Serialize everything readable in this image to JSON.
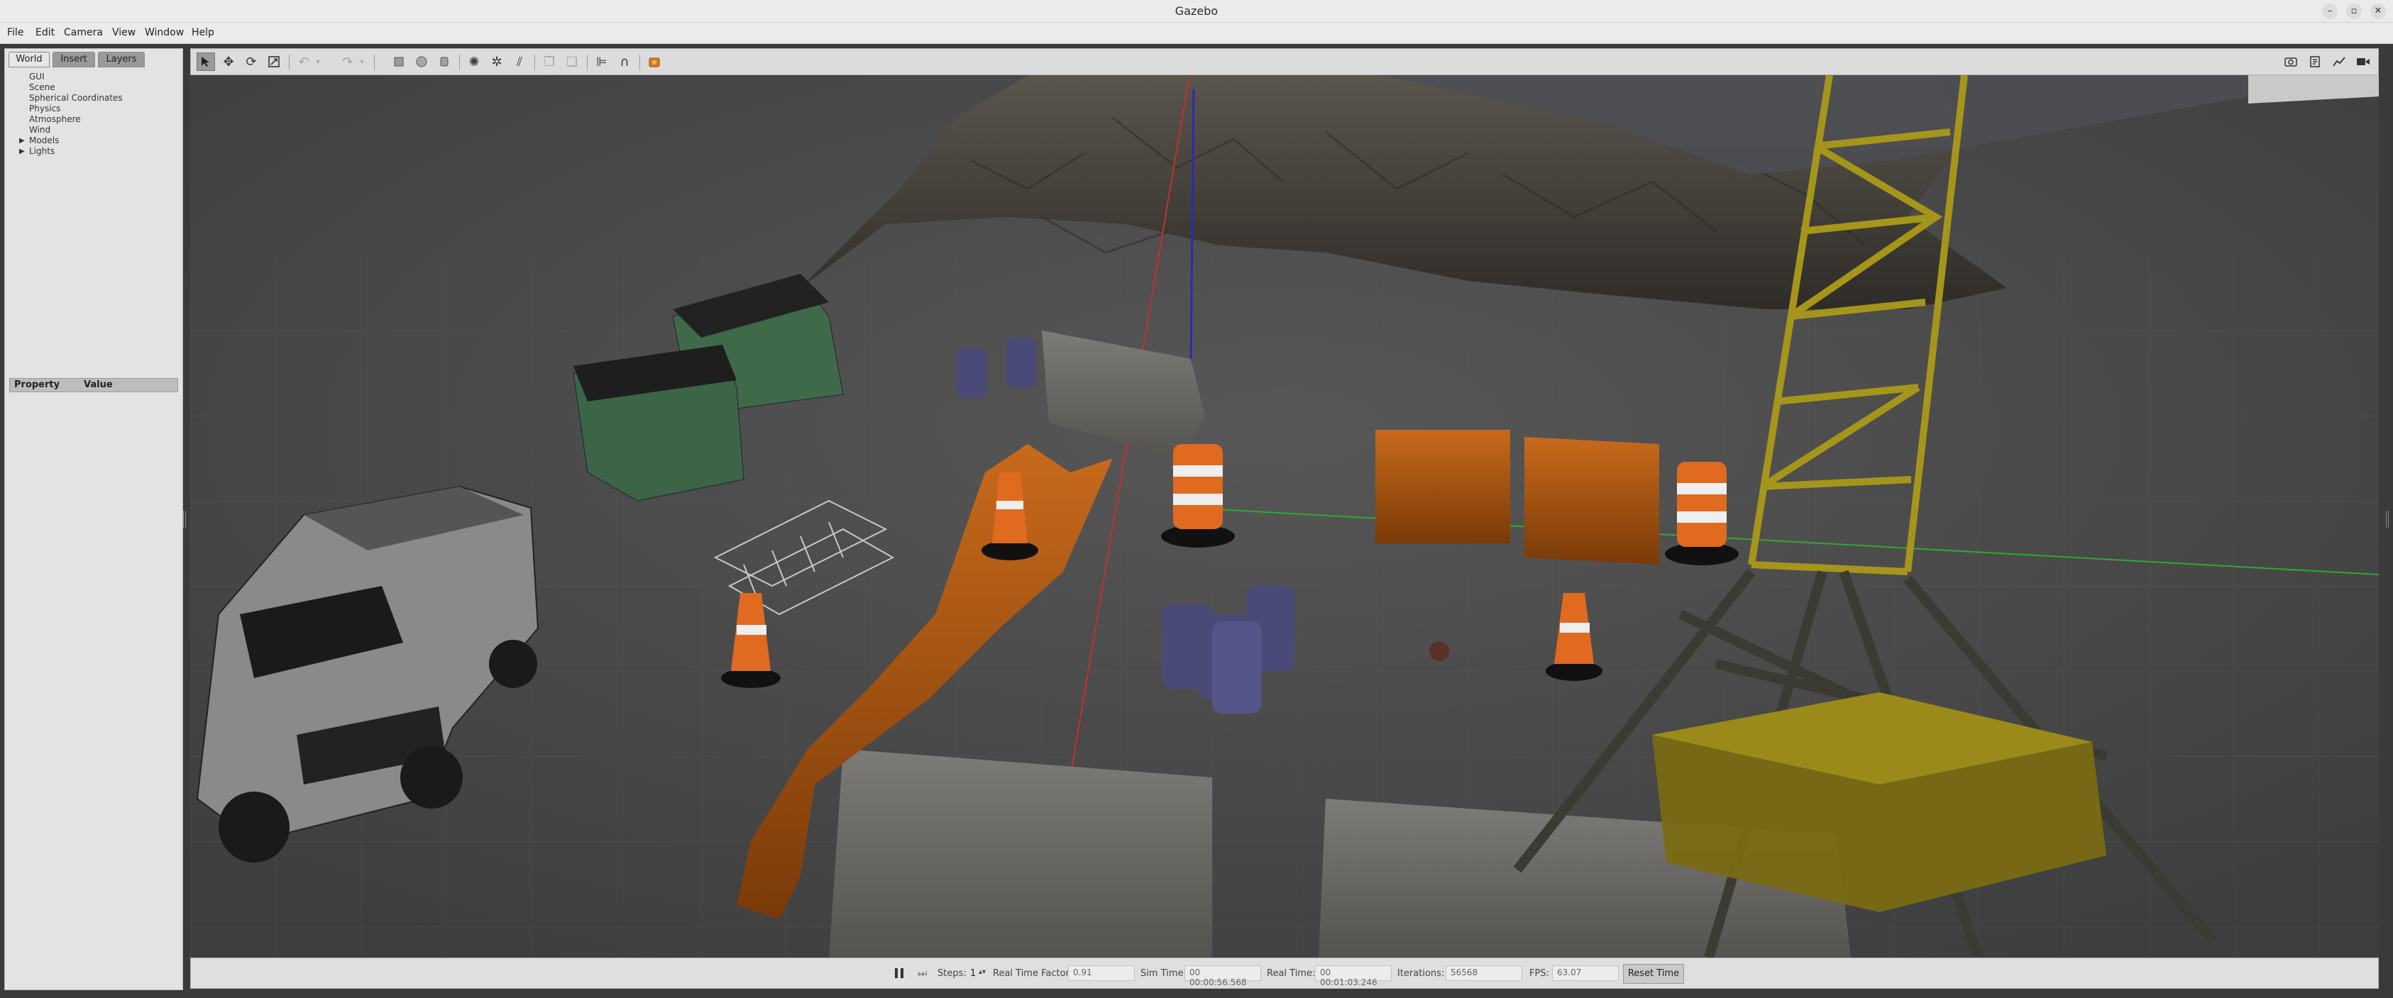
{
  "window": {
    "title": "Gazebo"
  },
  "menu": [
    "File",
    "Edit",
    "Camera",
    "View",
    "Window",
    "Help"
  ],
  "left_panel": {
    "tabs": [
      {
        "label": "World",
        "active": true
      },
      {
        "label": "Insert",
        "active": false
      },
      {
        "label": "Layers",
        "active": false
      }
    ],
    "tree": [
      {
        "label": "GUI",
        "expandable": false
      },
      {
        "label": "Scene",
        "expandable": false
      },
      {
        "label": "Spherical Coordinates",
        "expandable": false
      },
      {
        "label": "Physics",
        "expandable": false
      },
      {
        "label": "Atmosphere",
        "expandable": false
      },
      {
        "label": "Wind",
        "expandable": false
      },
      {
        "label": "Models",
        "expandable": true
      },
      {
        "label": "Lights",
        "expandable": true
      }
    ],
    "property_header": {
      "property": "Property",
      "value": "Value"
    }
  },
  "toolbar": {
    "left_icons": [
      "select-arrow-icon",
      "translate-icon",
      "rotate-icon",
      "scale-icon",
      "undo-icon",
      "undo-dropdown-icon",
      "redo-icon",
      "redo-dropdown-icon",
      "box-shape-icon",
      "sphere-shape-icon",
      "cylinder-shape-icon",
      "point-light-icon",
      "spot-light-icon",
      "directional-light-icon",
      "copy-icon",
      "paste-icon",
      "align-icon",
      "snap-icon",
      "orange-view-angle-icon"
    ],
    "right_icons": [
      "screenshot-icon",
      "log-icon",
      "plot-icon",
      "video-record-icon"
    ]
  },
  "bottom_bar": {
    "steps_label": "Steps:",
    "steps_value": "1",
    "rtf_label": "Real Time Factor:",
    "rtf_value": "0.91",
    "sim_time_label": "Sim Time:",
    "sim_time_value": "00 00:00:56.568",
    "real_time_label": "Real Time:",
    "real_time_value": "00 00:01:03.246",
    "iterations_label": "Iterations:",
    "iterations_value": "56568",
    "fps_label": "FPS:",
    "fps_value": "63.07",
    "reset_label": "Reset Time"
  },
  "colors": {
    "barrier_orange": "#b35a12",
    "crane_yellow": "#9a8a1a",
    "dumpster_green": "#3e6a4a",
    "x_axis": "#c23030",
    "y_axis": "#2fa82f",
    "z_axis": "#2a2ab8"
  }
}
